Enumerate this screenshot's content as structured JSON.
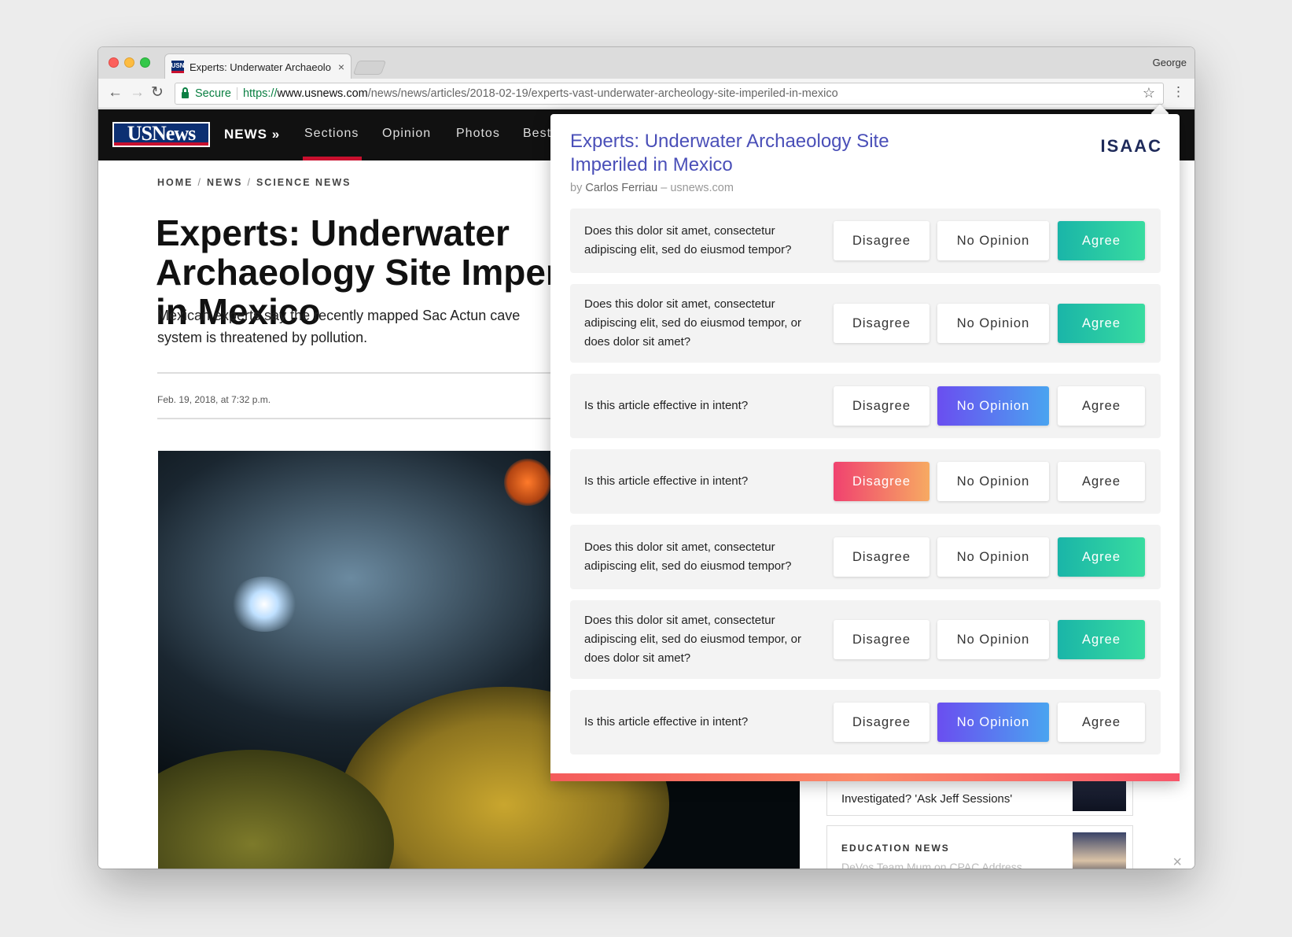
{
  "browser": {
    "tab_title": "Experts: Underwater Archaeolo",
    "tab_close": "×",
    "profile_name": "George",
    "secure_label": "Secure",
    "url_scheme": "https://",
    "url_host": "www.usnews.com",
    "url_path": "/news/news/articles/2018-02-19/experts-vast-underwater-archeology-site-imperiled-in-mexico",
    "favicon_text": "USN"
  },
  "site": {
    "logo_text": "USNews",
    "nav": {
      "news": "NEWS »",
      "sections": "Sections",
      "opinion": "Opinion",
      "photos": "Photos",
      "best": "Best"
    },
    "breadcrumb": [
      "HOME",
      "NEWS",
      "SCIENCE NEWS"
    ],
    "breadcrumb_sep": "/",
    "headline": "Experts: Underwater Archaeology Site Imperiled in Mexico",
    "dek": "Mexican experts say the recently mapped Sac Actun cave system is threatened by pollution.",
    "dateline": "Feb. 19, 2018, at 7:32 p.m.",
    "sidebar": {
      "story1_text": "Investigated? 'Ask Jeff Sessions'",
      "story2_label": "EDUCATION NEWS",
      "story2_text": "DeVos Team Mum on CPAC Address"
    },
    "close_glyph": "×"
  },
  "extension": {
    "brand": "ISAAC",
    "title": "Experts: Underwater Archaeology Site Imperiled in Mexico",
    "byline_prefix": "by",
    "author": "Carlos Ferriau",
    "source": "– usnews.com",
    "labels": {
      "disagree": "Disagree",
      "no_opinion": "No Opinion",
      "agree": "Agree"
    },
    "questions": [
      {
        "text": "Does this dolor sit amet, consectetur adipiscing elit, sed do eiusmod tempor?",
        "selected": "agree"
      },
      {
        "text": "Does this dolor sit amet, consectetur adipiscing elit, sed do eiusmod tempor, or does dolor sit amet?",
        "selected": "agree"
      },
      {
        "text": "Is this article effective in intent?",
        "selected": "no_opinion"
      },
      {
        "text": "Is this article effective in intent?",
        "selected": "disagree"
      },
      {
        "text": "Does this dolor sit amet, consectetur adipiscing elit, sed do eiusmod tempor?",
        "selected": "agree"
      },
      {
        "text": "Does this dolor sit amet, consectetur adipiscing elit, sed do eiusmod tempor, or does dolor sit amet?",
        "selected": "agree"
      },
      {
        "text": "Is this article effective in intent?",
        "selected": "no_opinion"
      }
    ],
    "colors": {
      "title": "#4a4fb8",
      "brand": "#1e2a5a",
      "agree": "#1ab5a8",
      "no_opinion": "#6a4ef0",
      "disagree": "#f0426f"
    }
  }
}
